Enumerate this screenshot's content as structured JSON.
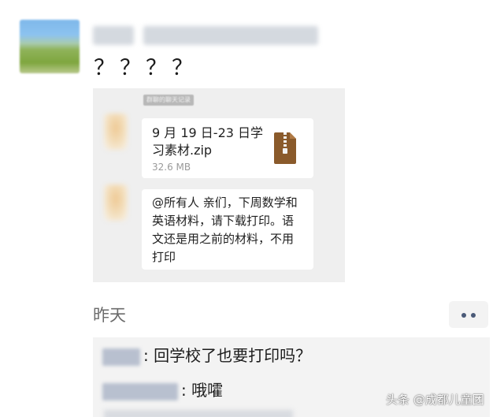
{
  "post": {
    "text": "？？？？",
    "forward": {
      "tag": "群聊的聊天记录",
      "file": {
        "name": "9 月 19 日-23 日学习素材.zip",
        "size": "32.6 MB",
        "icon": "zip-archive-icon"
      },
      "message": "@所有人 亲们，下周数学和英语材料，请下载打印。语文还是用之前的材料，不用打印"
    },
    "time": "昨天",
    "more_icon": "more-dots-icon"
  },
  "comments": [
    {
      "text": ": 回学校了也要打印吗？"
    },
    {
      "text": ": 哦嚯"
    }
  ],
  "watermark": "头条 @成都儿童团"
}
